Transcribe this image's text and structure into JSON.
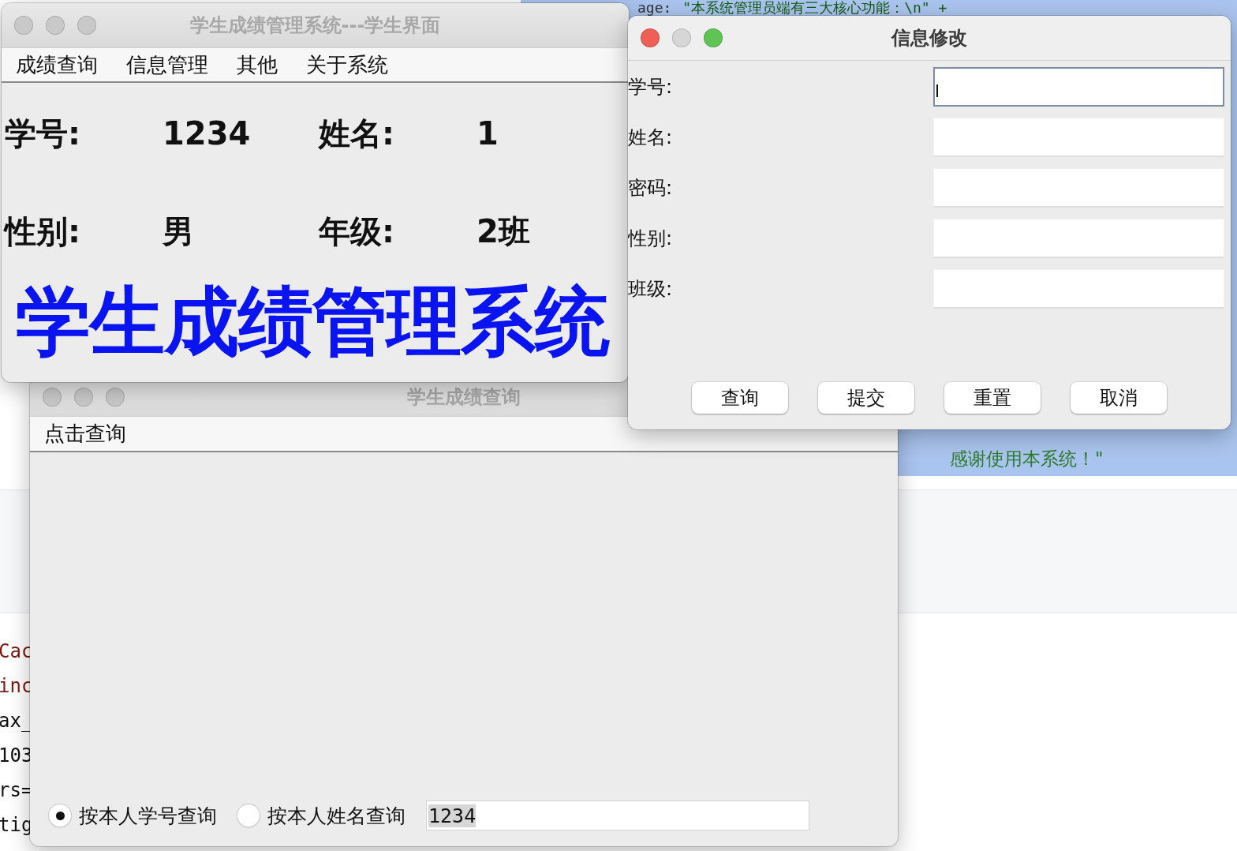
{
  "editor": {
    "top_line": {
      "key": "age:",
      "value": "\"本系统管理员端有三大核心功能：\\n\" +"
    },
    "closing_line": "感谢使用本系统！\"",
    "left_fragments": [
      {
        "text": "Cac",
        "kind": "keyword"
      },
      {
        "text": "inc",
        "kind": "keyword"
      },
      {
        "text": "ax_",
        "kind": "plain"
      },
      {
        "text": "103",
        "kind": "plain"
      },
      {
        "text": "rs=",
        "kind": "plain"
      },
      {
        "text": "tig",
        "kind": "plain"
      }
    ]
  },
  "query_window": {
    "title": "学生成绩查询",
    "menu": [
      "点击查询"
    ],
    "options": [
      {
        "label": "按本人学号查询",
        "selected": true
      },
      {
        "label": "按本人姓名查询",
        "selected": false
      }
    ],
    "search": {
      "value": "1234"
    }
  },
  "student_window": {
    "title": "学生成绩管理系统---学生界面",
    "menu": [
      "成绩查询",
      "信息管理",
      "其他",
      "关于系统"
    ],
    "fields": [
      {
        "label": "学号:",
        "value": "1234"
      },
      {
        "label": "姓名:",
        "value": "1"
      },
      {
        "label": "性别:",
        "value": "男"
      },
      {
        "label": "年级:",
        "value": "2班"
      }
    ],
    "banner": "学生成绩管理系统"
  },
  "edit_dialog": {
    "title": "信息修改",
    "fields": [
      {
        "label": "学号:",
        "focused": true
      },
      {
        "label": "姓名:",
        "focused": false
      },
      {
        "label": "密码:",
        "focused": false
      },
      {
        "label": "性别:",
        "focused": false
      },
      {
        "label": "班级:",
        "focused": false
      }
    ],
    "buttons": [
      "查询",
      "提交",
      "重置",
      "取消"
    ]
  }
}
